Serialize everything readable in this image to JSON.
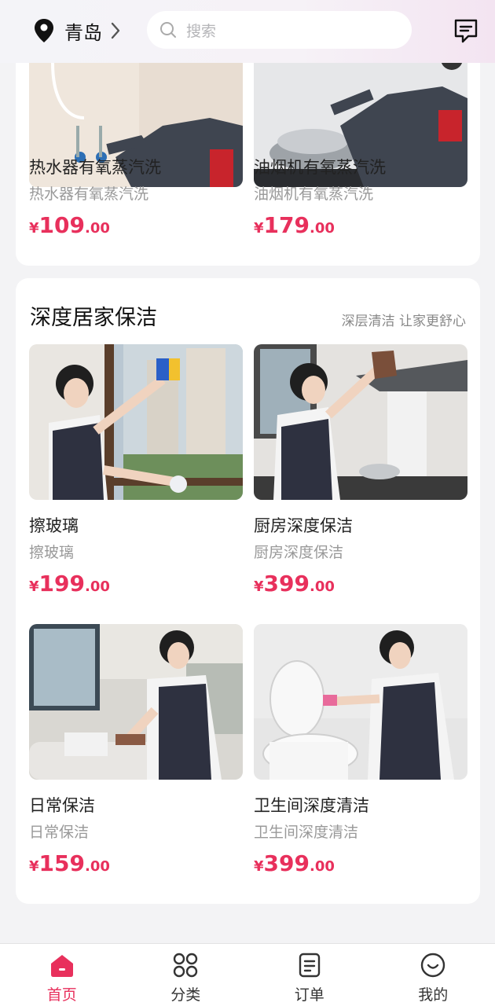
{
  "header": {
    "city": "青岛",
    "search_placeholder": "搜索"
  },
  "top_section": {
    "items": [
      {
        "name": "热水器有氧蒸汽洗",
        "desc": "热水器有氧蒸汽洗",
        "price_int": "109",
        "price_dec": ".00",
        "currency": "¥"
      },
      {
        "name": "油烟机有氧蒸汽洗",
        "desc": "油烟机有氧蒸汽洗",
        "price_int": "179",
        "price_dec": ".00",
        "currency": "¥"
      }
    ]
  },
  "deep_clean": {
    "title": "深度居家保洁",
    "subtitle": "深层清洁 让家更舒心",
    "items": [
      {
        "name": "擦玻璃",
        "desc": "擦玻璃",
        "price_int": "199",
        "price_dec": ".00",
        "currency": "¥"
      },
      {
        "name": "厨房深度保洁",
        "desc": "厨房深度保洁",
        "price_int": "399",
        "price_dec": ".00",
        "currency": "¥"
      },
      {
        "name": "日常保洁",
        "desc": "日常保洁",
        "price_int": "159",
        "price_dec": ".00",
        "currency": "¥"
      },
      {
        "name": "卫生间深度清洁",
        "desc": "卫生间深度清洁",
        "price_int": "399",
        "price_dec": ".00",
        "currency": "¥"
      }
    ]
  },
  "tabbar": {
    "items": [
      {
        "label": "首页",
        "icon": "home-icon"
      },
      {
        "label": "分类",
        "icon": "grid-icon"
      },
      {
        "label": "订单",
        "icon": "document-icon"
      },
      {
        "label": "我的",
        "icon": "smile-icon"
      }
    ]
  },
  "colors": {
    "accent": "#e8305c",
    "background": "#f3f3f5"
  }
}
